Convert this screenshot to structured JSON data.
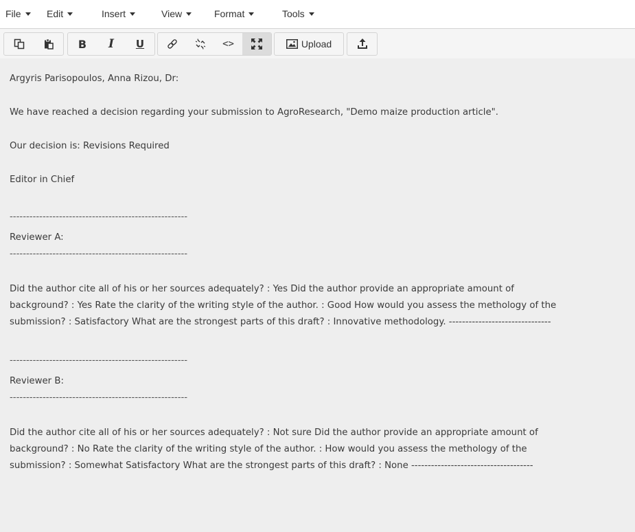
{
  "menubar": {
    "items": [
      "File",
      "Edit",
      "Insert",
      "View",
      "Format",
      "Tools"
    ]
  },
  "toolbar": {
    "copy_icon": "copy-icon",
    "paste_icon": "paste-icon",
    "bold_label": "B",
    "italic_label": "I",
    "underline_label": "U",
    "link_icon": "link-icon",
    "unlink_icon": "unlink-icon",
    "code_label": "<>",
    "fullscreen_icon": "fullscreen-icon",
    "upload_label": "Upload",
    "attach_icon": "attach-icon"
  },
  "document": {
    "recipient": "Argyris Parisopoulos, Anna Rizou, Dr:",
    "intro": "We have reached a decision regarding your submission to AgroResearch, \"Demo maize production article\".",
    "decision": "Our decision is: Revisions Required",
    "signature": "Editor in Chief",
    "separator": "------------------------------------------------------",
    "reviewer_a": {
      "title": "Reviewer A:",
      "line1": "Did the author cite all of his or her sources adequately? : Yes Did the author provide an appropriate amount of",
      "line2": "background? : Yes Rate the clarity of the writing style of the author. : Good How would you assess the methology of the",
      "line3": "submission? : Satisfactory What are the strongest parts of this draft? : Innovative methodology. -------------------------------"
    },
    "reviewer_b": {
      "title": "Reviewer B:",
      "line1": "Did the author cite all of his or her sources adequately? : Not sure Did the author provide an appropriate amount of",
      "line2": "background? : No Rate the clarity of the writing style of the author. : How would you assess the methology of the",
      "line3": "submission? : Somewhat Satisfactory What are the strongest parts of this draft? : None -------------------------------------"
    }
  }
}
